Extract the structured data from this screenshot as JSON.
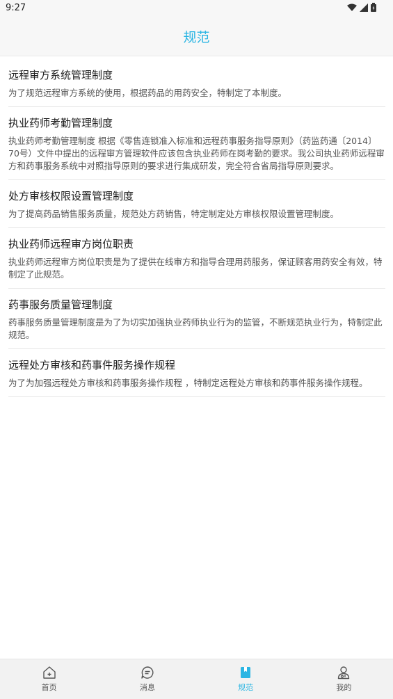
{
  "status_bar": {
    "time": "9:27"
  },
  "header": {
    "title": "规范"
  },
  "items": [
    {
      "title": "远程审方系统管理制度",
      "desc": "为了规范远程审方系统的使用，根据药品的用药安全，特制定了本制度。"
    },
    {
      "title": "执业药师考勤管理制度",
      "desc": "执业药师考勤管理制度 根据《零售连锁准入标准和远程药事服务指导原则》（药监药通〔2014〕70号）文件中提出的远程审方管理软件应该包含执业药师在岗考勤的要求。我公司执业药师远程审方和药事服务系统中对照指导原则的要求进行集成研发，完全符合省局指导原则要求。"
    },
    {
      "title": "处方审核权限设置管理制度",
      "desc": "为了提高药品销售服务质量，规范处方药销售，特定制定处方审核权限设置管理制度。"
    },
    {
      "title": "执业药师远程审方岗位职责",
      "desc": "执业药师远程审方岗位职责是为了提供在线审方和指导合理用药服务，保证顾客用药安全有效，特制定了此规范。"
    },
    {
      "title": "药事服务质量管理制度",
      "desc": "药事服务质量管理制度是为了为切实加强执业药师执业行为的监管，不断规范执业行为，特制定此规范。"
    },
    {
      "title": "远程处方审核和药事件服务操作规程",
      "desc": "为了为加强远程处方审核和药事服务操作规程 ，特制定远程处方审核和药事件服务操作规程。"
    }
  ],
  "tabs": [
    {
      "label": "首页",
      "icon": "home-icon"
    },
    {
      "label": "消息",
      "icon": "message-icon"
    },
    {
      "label": "规范",
      "icon": "book-icon"
    },
    {
      "label": "我的",
      "icon": "profile-icon"
    }
  ],
  "colors": {
    "accent": "#2bb5e3",
    "inactive": "#555555"
  }
}
